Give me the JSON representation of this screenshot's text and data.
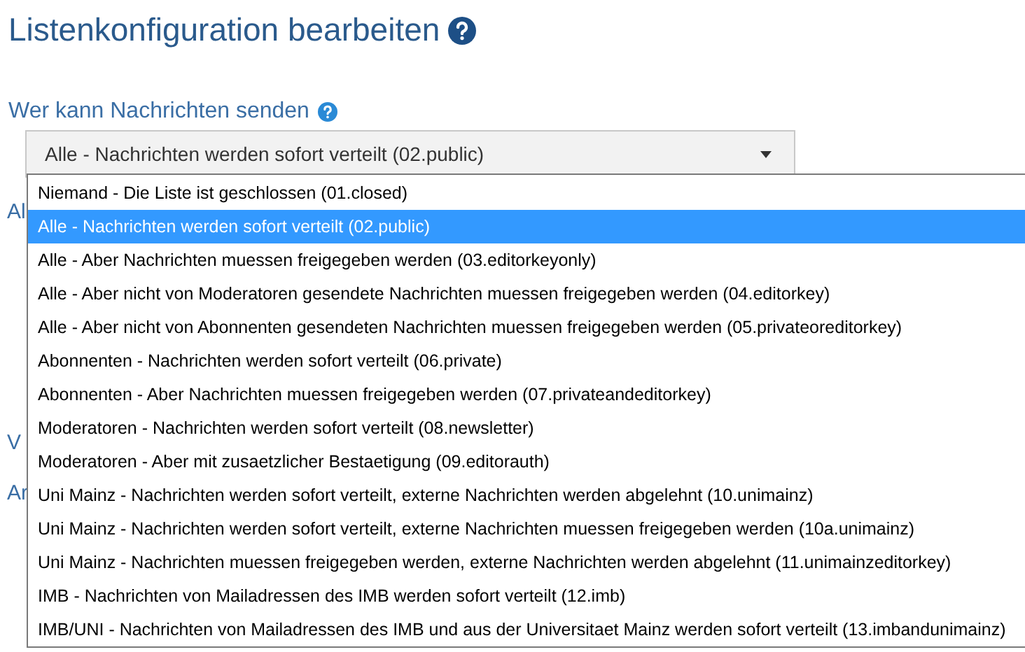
{
  "heading": "Listenkonfiguration bearbeiten",
  "field": {
    "label": "Wer kann Nachrichten senden",
    "value": "Alle - Nachrichten werden sofort verteilt (02.public)",
    "expanded": true
  },
  "hidden_labels": [
    "Al",
    "V",
    "Ar"
  ],
  "options": [
    {
      "label": "Niemand - Die Liste ist geschlossen (01.closed)",
      "selected": false
    },
    {
      "label": "Alle - Nachrichten werden sofort verteilt (02.public)",
      "selected": true
    },
    {
      "label": "Alle - Aber Nachrichten muessen freigegeben werden (03.editorkeyonly)",
      "selected": false
    },
    {
      "label": "Alle - Aber nicht von Moderatoren gesendete Nachrichten muessen freigegeben werden (04.editorkey)",
      "selected": false
    },
    {
      "label": "Alle - Aber nicht von Abonnenten gesendeten Nachrichten muessen freigegeben werden (05.privateoreditorkey)",
      "selected": false
    },
    {
      "label": "Abonnenten - Nachrichten werden sofort verteilt (06.private)",
      "selected": false
    },
    {
      "label": "Abonnenten - Aber Nachrichten muessen freigegeben werden (07.privateandeditorkey)",
      "selected": false
    },
    {
      "label": "Moderatoren - Nachrichten werden sofort verteilt (08.newsletter)",
      "selected": false
    },
    {
      "label": "Moderatoren - Aber mit zusaetzlicher Bestaetigung (09.editorauth)",
      "selected": false
    },
    {
      "label": "Uni Mainz - Nachrichten werden sofort verteilt, externe Nachrichten werden abgelehnt (10.unimainz)",
      "selected": false
    },
    {
      "label": "Uni Mainz - Nachrichten werden sofort verteilt, externe Nachrichten muessen freigegeben werden (10a.unimainz)",
      "selected": false
    },
    {
      "label": "Uni Mainz - Nachrichten muessen freigegeben werden, externe Nachrichten werden abgelehnt (11.unimainzeditorkey)",
      "selected": false
    },
    {
      "label": "IMB - Nachrichten von Mailadressen des IMB werden sofort verteilt (12.imb)",
      "selected": false
    },
    {
      "label": "IMB/UNI - Nachrichten von Mailadressen des IMB und aus der Universitaet Mainz werden sofort verteilt (13.imbandunimainz)",
      "selected": false
    }
  ]
}
